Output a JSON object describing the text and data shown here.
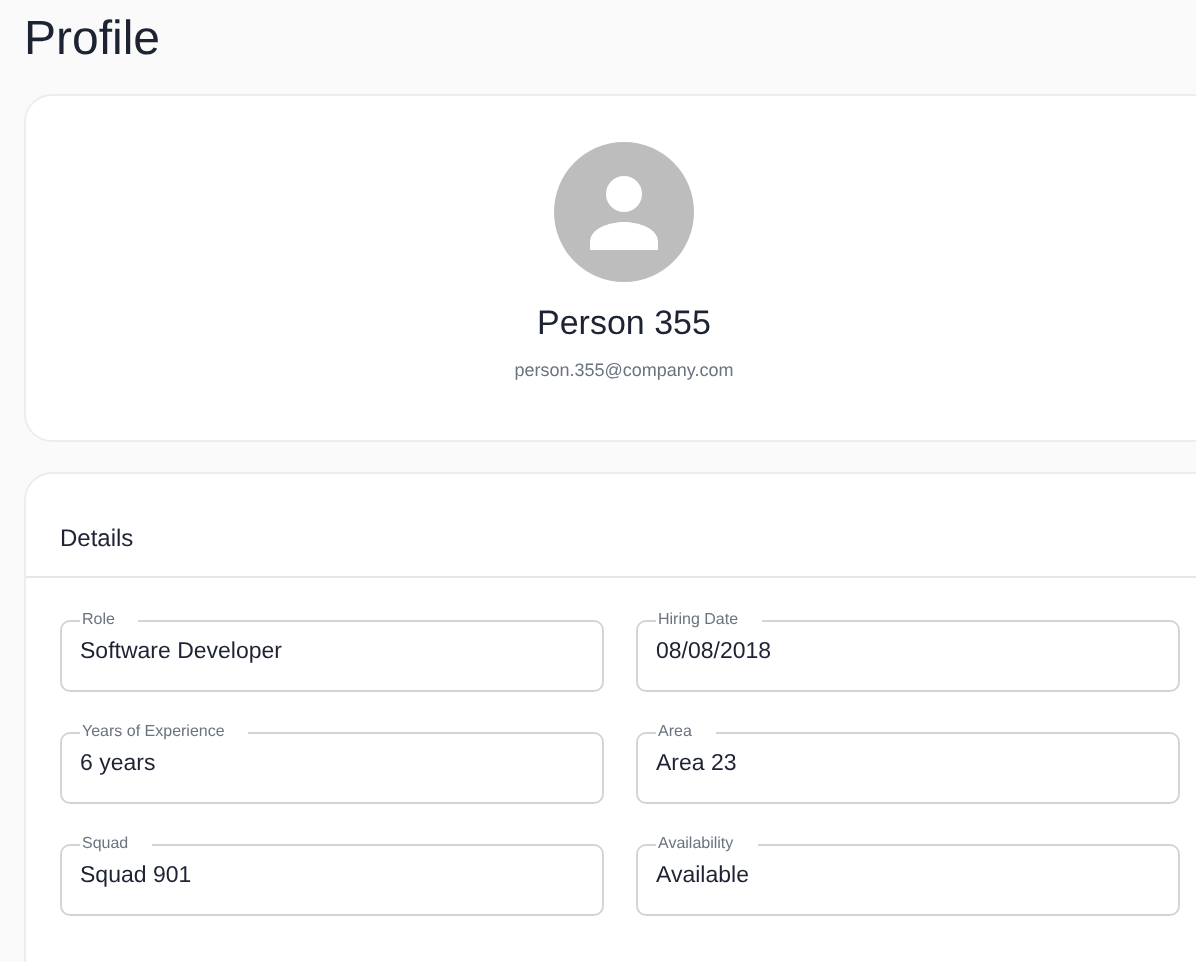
{
  "page": {
    "title": "Profile"
  },
  "profile": {
    "name": "Person 355",
    "email": "person.355@company.com"
  },
  "details": {
    "title": "Details",
    "fields": [
      {
        "label": "Role",
        "value": "Software Developer"
      },
      {
        "label": "Hiring Date",
        "value": "08/08/2018"
      },
      {
        "label": "Years of Experience",
        "value": "6 years"
      },
      {
        "label": "Area",
        "value": "Area 23"
      },
      {
        "label": "Squad",
        "value": "Squad 901"
      },
      {
        "label": "Availability",
        "value": "Available"
      }
    ]
  }
}
